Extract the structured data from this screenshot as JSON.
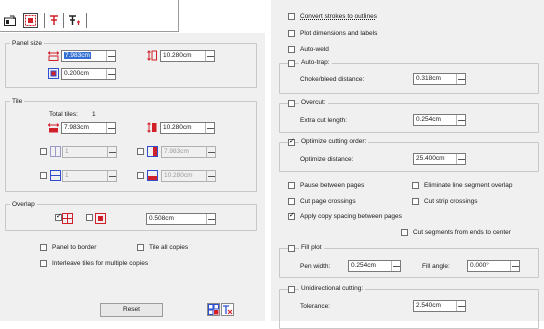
{
  "left": {
    "panel_size": {
      "title": "Panel size",
      "width": "7.983cm",
      "height": "10.280cm",
      "margin": "0.200cm"
    },
    "tile": {
      "title": "Tile",
      "total_tiles_label": "Total tiles:",
      "total_tiles_value": "1",
      "tile_width": "7.983cm",
      "tile_height": "10.280cm",
      "cols": "1",
      "col_width": "7.983cm",
      "rows": "1",
      "row_height": "10.280cm"
    },
    "overlap": {
      "title": "Overlap",
      "value": "0.508cm"
    },
    "options": {
      "panel_to_border": "Panel to border",
      "tile_all_copies": "Tile all copies",
      "interleave": "Interleave tiles for multiple copies"
    },
    "reset_label": "Reset"
  },
  "right": {
    "convert_strokes": "Convert strokes to outlines",
    "plot_dimensions": "Plot dimensions and labels",
    "auto_weld": "Auto-weld",
    "auto_trap": {
      "title": "Auto-trap:",
      "label": "Choke/bleed distance:",
      "value": "0.318cm"
    },
    "overcut": {
      "title": "Overcut:",
      "label": "Extra cut length:",
      "value": "0.254cm"
    },
    "optimize": {
      "title": "Optimize cutting order:",
      "label": "Optimize distance:",
      "value": "25.400cm"
    },
    "pause_between_pages": "Pause between pages",
    "eliminate_overlap": "Eliminate line segment overlap",
    "cut_page_crossings": "Cut page crossings",
    "cut_strip_crossings": "Cut strip crossings",
    "apply_copy_spacing": "Apply copy spacing between pages",
    "cut_segments": "Cut segments from ends to center",
    "fill_plot": {
      "title": "Fill plot",
      "pen_width_label": "Pen width:",
      "pen_width": "0.254cm",
      "fill_angle_label": "Fill angle:",
      "fill_angle": "0.000°"
    },
    "unidirectional": {
      "title": "Unidirectional cutting:",
      "tolerance_label": "Tolerance:",
      "tolerance": "2.540cm"
    }
  },
  "colors": {
    "panel_bg": "#f0f0f0",
    "accent_red": "#d0202a",
    "accent_blue": "#2c4fd0",
    "selection": "#3470d4"
  }
}
